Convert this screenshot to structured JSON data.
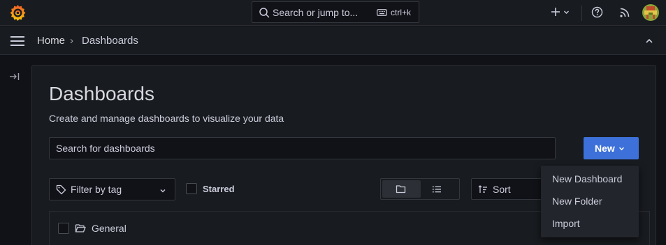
{
  "topbar": {
    "search_placeholder": "Search or jump to...",
    "shortcut": "ctrl+k"
  },
  "breadcrumb": {
    "home": "Home",
    "separator": "›",
    "current": "Dashboards"
  },
  "page": {
    "title": "Dashboards",
    "subtitle": "Create and manage dashboards to visualize your data",
    "search_placeholder": "Search for dashboards",
    "new_button": "New"
  },
  "filters": {
    "tag_filter": "Filter by tag",
    "starred": "Starred",
    "sort": "Sort"
  },
  "folders": [
    {
      "label": "General"
    }
  ],
  "new_menu": {
    "items": [
      "New Dashboard",
      "New Folder",
      "Import"
    ]
  },
  "colors": {
    "primary": "#3d71d9",
    "logo_orange": "#f05a28",
    "background": "#111217",
    "panel": "#181b1f"
  }
}
